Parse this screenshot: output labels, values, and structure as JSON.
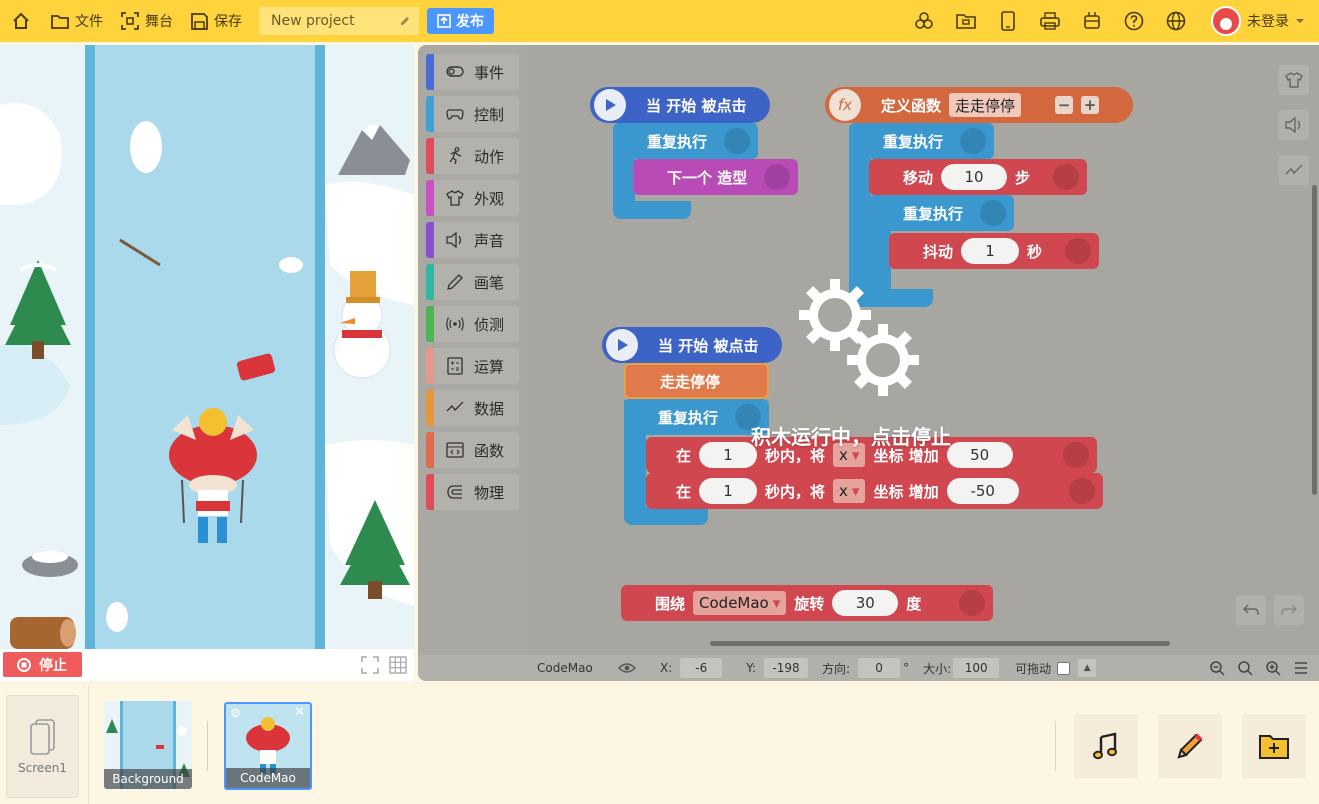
{
  "topbar": {
    "file_label": "文件",
    "stage_label": "舞台",
    "save_label": "保存",
    "project_name": "New project",
    "publish_label": "发布",
    "user_label": "未登录"
  },
  "stage": {
    "stop_label": "停止"
  },
  "palette": {
    "categories": [
      {
        "label": "事件",
        "color": "#4a6cd4",
        "icon": "toggle-icon"
      },
      {
        "label": "控制",
        "color": "#3fa0d2",
        "icon": "gamepad-icon"
      },
      {
        "label": "动作",
        "color": "#e04b5a",
        "icon": "runner-icon"
      },
      {
        "label": "外观",
        "color": "#c94fc4",
        "icon": "shirt-icon"
      },
      {
        "label": "声音",
        "color": "#8a4ed1",
        "icon": "speaker-icon"
      },
      {
        "label": "画笔",
        "color": "#2fb8a1",
        "icon": "pen-icon"
      },
      {
        "label": "侦测",
        "color": "#4cb652",
        "icon": "sensor-icon"
      },
      {
        "label": "运算",
        "color": "#e4988e",
        "icon": "calculator-icon"
      },
      {
        "label": "数据",
        "color": "#e8963a",
        "icon": "graph-icon"
      },
      {
        "label": "函数",
        "color": "#e06b4a",
        "icon": "code-icon"
      },
      {
        "label": "物理",
        "color": "#e04b5a",
        "icon": "magnet-icon"
      }
    ]
  },
  "blocks": {
    "hat1_label": "当 开始 被点击",
    "repeat1_label": "重复执行",
    "next_costume_label": "下一个 造型",
    "define_label": "定义函数",
    "define_name": "走走停停",
    "define_fx": "fx",
    "repeat2_label": "重复执行",
    "move_label": "移动",
    "move_steps": "10",
    "move_unit": "步",
    "repeat3_label": "重复执行",
    "shake_label": "抖动",
    "shake_secs": "1",
    "shake_unit": "秒",
    "hat2_label": "当 开始 被点击",
    "call_label": "走走停停",
    "repeat4_label": "重复执行",
    "glide1": {
      "in": "在",
      "secs": "1",
      "mid": "秒内，将",
      "axis": "x",
      "coord": "坐标 增加",
      "value": "50"
    },
    "glide2": {
      "in": "在",
      "secs": "1",
      "mid": "秒内，将",
      "axis": "x",
      "coord": "坐标 增加",
      "value": "-50"
    },
    "rotate": {
      "around": "围绕",
      "target": "CodeMao",
      "rotate": "旋转",
      "value": "30",
      "unit": "度"
    }
  },
  "running_text": "积木运行中，点击停止",
  "statusbar": {
    "sprite_name": "CodeMao",
    "x_label": "X:",
    "x_value": "-6",
    "y_label": "Y:",
    "y_value": "-198",
    "dir_label": "方向:",
    "dir_value": "0",
    "dir_unit": "°",
    "size_label": "大小:",
    "size_value": "100",
    "drag_label": "可拖动"
  },
  "bottom": {
    "screen_label": "Screen1",
    "sprites": [
      {
        "label": "Background"
      },
      {
        "label": "CodeMao"
      }
    ]
  }
}
